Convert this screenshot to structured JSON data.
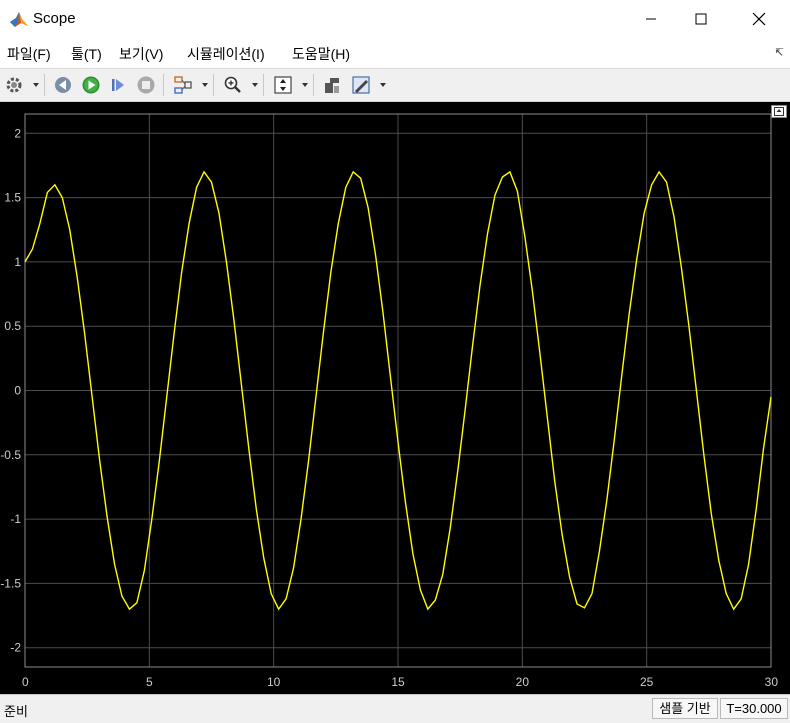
{
  "window": {
    "title": "Scope"
  },
  "menu": [
    "파일(F)",
    "툴(T)",
    "보기(V)",
    "시뮬레이션(I)",
    "도움말(H)"
  ],
  "toolbar": {
    "icons": [
      "gear-icon",
      "step-back-icon",
      "run-icon",
      "step-forward-icon",
      "stop-icon",
      "signal-select-icon",
      "zoom-icon",
      "scale-axes-icon",
      "highlight-block-icon",
      "style-icon"
    ]
  },
  "status": {
    "ready": "준비",
    "mode": "샘플 기반",
    "time": "T=30.000"
  },
  "colors": {
    "plot_bg": "#000000",
    "grid": "#4d4d4d",
    "trace": "#ffff00",
    "tick": "#cccccc"
  },
  "chart_data": {
    "type": "line",
    "title": "",
    "xlabel": "",
    "ylabel": "",
    "xlim": [
      0,
      30
    ],
    "ylim": [
      -2.15,
      2.15
    ],
    "xticks": [
      0,
      5,
      10,
      15,
      20,
      25,
      30
    ],
    "yticks": [
      2,
      1.5,
      1,
      0.5,
      0,
      -0.5,
      -1,
      -1.5,
      -2
    ],
    "xtick_labels": [
      "0",
      "5",
      "10",
      "15",
      "20",
      "25",
      "30"
    ],
    "ytick_labels": [
      "2",
      "1.5",
      "1",
      "0.5",
      "0",
      "-0.5",
      "-1",
      "-1.5",
      "-2"
    ],
    "grid": true,
    "series": [
      {
        "x": [
          0,
          0.3,
          0.6,
          0.9,
          1.2,
          1.5,
          1.8,
          2.1,
          2.4,
          2.7,
          3.0,
          3.3,
          3.6,
          3.9,
          4.2,
          4.5,
          4.8,
          5.1,
          5.4,
          5.7,
          6.0,
          6.3,
          6.6,
          6.9,
          7.2,
          7.5,
          7.8,
          8.1,
          8.4,
          8.7,
          9.0,
          9.3,
          9.6,
          9.9,
          10.2,
          10.5,
          10.8,
          11.1,
          11.4,
          11.7,
          12.0,
          12.3,
          12.6,
          12.9,
          13.2,
          13.5,
          13.8,
          14.1,
          14.4,
          14.7,
          15.0,
          15.3,
          15.6,
          15.9,
          16.2,
          16.5,
          16.8,
          17.1,
          17.4,
          17.7,
          18.0,
          18.3,
          18.6,
          18.9,
          19.2,
          19.5,
          19.8,
          20.1,
          20.4,
          20.7,
          21.0,
          21.3,
          21.6,
          21.9,
          22.2,
          22.5,
          22.8,
          23.1,
          23.4,
          23.7,
          24.0,
          24.3,
          24.6,
          24.9,
          25.2,
          25.5,
          25.8,
          26.1,
          26.4,
          26.7,
          27.0,
          27.3,
          27.6,
          27.9,
          28.2,
          28.5,
          28.8,
          29.1,
          29.4,
          29.7,
          30.0
        ],
        "values": [
          1.0,
          1.1,
          1.3,
          1.54,
          1.6,
          1.5,
          1.25,
          0.88,
          0.44,
          -0.05,
          -0.54,
          -0.98,
          -1.35,
          -1.6,
          -1.7,
          -1.65,
          -1.4,
          -1.0,
          -0.55,
          -0.05,
          0.45,
          0.92,
          1.3,
          1.58,
          1.7,
          1.62,
          1.38,
          1.0,
          0.55,
          0.05,
          -0.45,
          -0.92,
          -1.3,
          -1.58,
          -1.7,
          -1.62,
          -1.38,
          -1.0,
          -0.55,
          -0.05,
          0.45,
          0.92,
          1.3,
          1.58,
          1.7,
          1.65,
          1.42,
          1.05,
          0.6,
          0.1,
          -0.4,
          -0.87,
          -1.27,
          -1.55,
          -1.7,
          -1.63,
          -1.43,
          -1.07,
          -0.63,
          -0.15,
          0.35,
          0.82,
          1.22,
          1.52,
          1.66,
          1.7,
          1.55,
          1.2,
          0.78,
          0.3,
          -0.2,
          -0.7,
          -1.12,
          -1.45,
          -1.66,
          -1.69,
          -1.58,
          -1.25,
          -0.85,
          -0.38,
          0.12,
          0.6,
          1.02,
          1.38,
          1.6,
          1.7,
          1.62,
          1.35,
          0.95,
          0.5,
          0.0,
          -0.5,
          -0.96,
          -1.32,
          -1.58,
          -1.7,
          -1.62,
          -1.35,
          -0.93,
          -0.45,
          -0.05
        ]
      }
    ]
  }
}
